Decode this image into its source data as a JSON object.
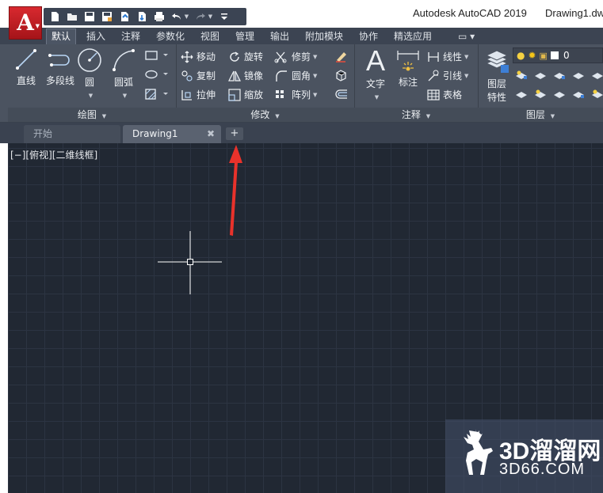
{
  "app": {
    "title": "Autodesk AutoCAD 2019",
    "document": "Drawing1.dw",
    "app_button_glyph": "A",
    "accent_color": "#c4161c"
  },
  "quick_access": {
    "icons": [
      "new-icon",
      "open-icon",
      "save-icon",
      "save-as-icon",
      "cloud-open-icon",
      "cloud-save-icon",
      "print-icon",
      "undo-icon",
      "redo-icon",
      "customize-icon"
    ]
  },
  "ribbon_tabs": [
    "默认",
    "插入",
    "注释",
    "参数化",
    "视图",
    "管理",
    "输出",
    "附加模块",
    "协作",
    "精选应用"
  ],
  "ribbon_tabs_active": "默认",
  "panels": {
    "draw": {
      "title": "绘图",
      "line": "直线",
      "polyline": "多段线",
      "circle": "圆",
      "arc": "圆弧"
    },
    "modify": {
      "title": "修改",
      "move": "移动",
      "rotate": "旋转",
      "trim": "修剪",
      "copy": "复制",
      "mirror": "镜像",
      "fillet": "圆角",
      "stretch": "拉伸",
      "scale": "缩放",
      "array": "阵列"
    },
    "annotation": {
      "title": "注释",
      "text": "文字",
      "dimension": "标注",
      "linear": "线性",
      "leader": "引线",
      "table": "表格"
    },
    "layers": {
      "title": "图层",
      "properties_line1": "图层",
      "properties_line2": "特性",
      "current_layer": "0"
    }
  },
  "doc_tabs": {
    "start": "开始",
    "drawing": "Drawing1",
    "close": "✖",
    "add": "+"
  },
  "viewport": {
    "label": "[−][俯视][二维线框]",
    "background": "#212833"
  },
  "watermark": {
    "line1": "3D溜溜网",
    "line2": "3D66.COM"
  }
}
